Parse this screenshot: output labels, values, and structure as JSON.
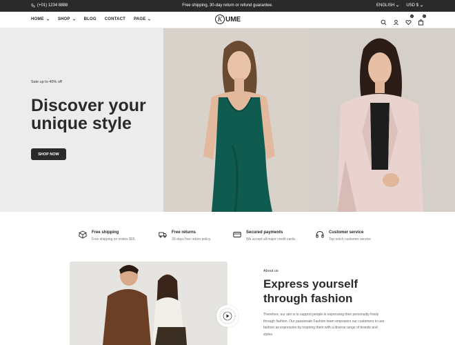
{
  "topbar": {
    "phone": "(+01) 1234 8888",
    "promo": "Free shipping, 30-day return or refund guarantee.",
    "language": "ENGLISH",
    "currency": "USD $"
  },
  "header": {
    "logo_text": "UME",
    "nav": [
      {
        "label": "HOME",
        "has_dropdown": true
      },
      {
        "label": "SHOP",
        "has_dropdown": true
      },
      {
        "label": "BLOG",
        "has_dropdown": false
      },
      {
        "label": "CONTACT",
        "has_dropdown": false
      },
      {
        "label": "PAGE",
        "has_dropdown": true
      }
    ],
    "wishlist_count": "0",
    "cart_count": "0"
  },
  "hero": {
    "subtitle": "Sale up to 40% off",
    "title_line1": "Discover your",
    "title_line2": "unique style",
    "button": "SHOP NOW"
  },
  "features": [
    {
      "icon": "box-icon",
      "title": "Free shipping",
      "desc": "Free shipping on orders $65."
    },
    {
      "icon": "truck-icon",
      "title": "Free returns",
      "desc": "30-days free return policy."
    },
    {
      "icon": "card-icon",
      "title": "Secured payments",
      "desc": "We accept all major credit cards."
    },
    {
      "icon": "headset-icon",
      "title": "Customer service",
      "desc": "Top notch customer service"
    }
  ],
  "about": {
    "label": "About us",
    "title_line1": "Express yourself",
    "title_line2": "through fashion",
    "text": "Therefore, our aim is to support people in expressing their personality freely through fashion. Our passionate Fashion team empowers our customers to use fashion as expression by inspiring them with a diverse range of brands and styles."
  },
  "colors": {
    "dark": "#2a2a2a",
    "hero_bg": "#ececec",
    "green_dress": "#0f5b50"
  }
}
